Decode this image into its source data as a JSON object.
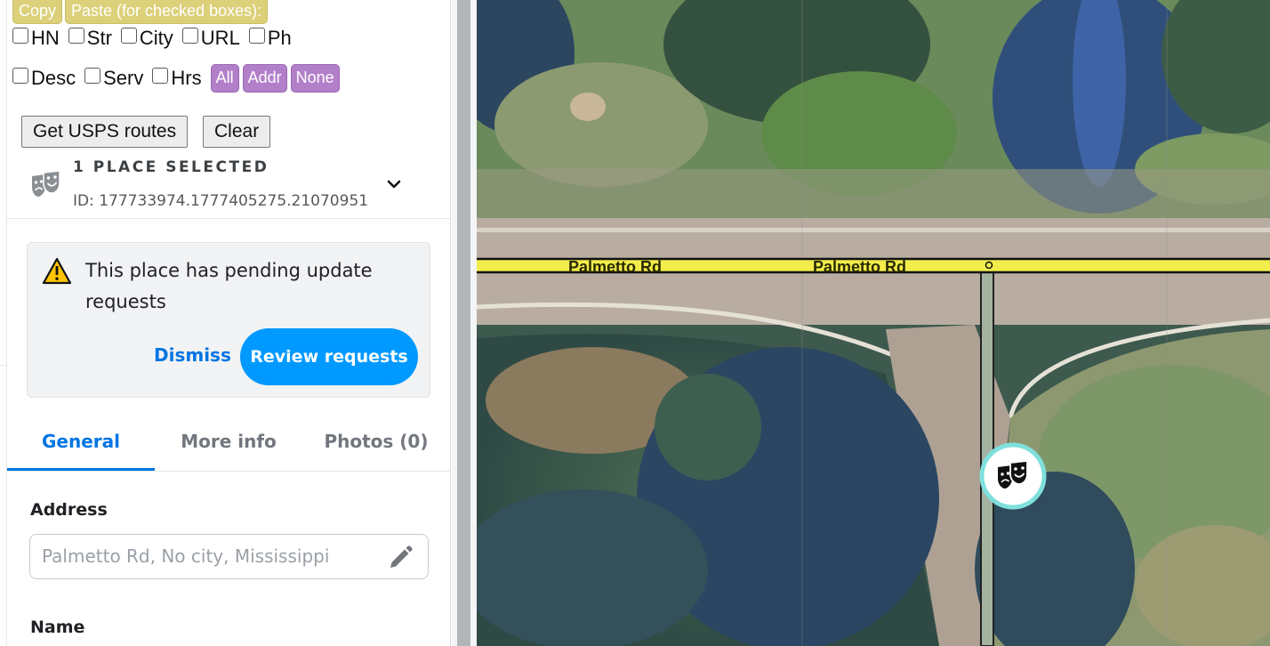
{
  "toolbar": {
    "copy_label": "Copy",
    "paste_label": "Paste (for checked boxes):"
  },
  "checkboxes_row1": [
    {
      "label": "HN",
      "checked": false
    },
    {
      "label": "Str",
      "checked": false
    },
    {
      "label": "City",
      "checked": false
    },
    {
      "label": "URL",
      "checked": false
    },
    {
      "label": "Ph",
      "checked": false
    }
  ],
  "checkboxes_row2": [
    {
      "label": "Desc",
      "checked": false
    },
    {
      "label": "Serv",
      "checked": false
    },
    {
      "label": "Hrs",
      "checked": false
    }
  ],
  "quick_buttons": {
    "all": "All",
    "addr": "Addr",
    "none": "None"
  },
  "usps": {
    "get_routes_label": "Get USPS routes",
    "clear_label": "Clear"
  },
  "selection": {
    "title": "1 PLACE SELECTED",
    "id_text": "ID: 177733974.1777405275.21070951",
    "icon": "theater-masks-icon"
  },
  "alert": {
    "message": "This place has pending update requests",
    "dismiss_label": "Dismiss",
    "review_label": "Review requests",
    "icon": "warning-triangle-icon"
  },
  "tabs": [
    {
      "label": "General",
      "active": true
    },
    {
      "label": "More info",
      "active": false
    },
    {
      "label": "Photos (0)",
      "active": false
    }
  ],
  "form": {
    "address_label": "Address",
    "address_value": "Palmetto Rd, No city, Mississippi",
    "name_label": "Name"
  },
  "map": {
    "road_name_left": "Palmetto Rd",
    "road_name_right": "Palmetto Rd",
    "marker_icon": "theater-masks-icon",
    "colors": {
      "road_fill": "#f2ed4a",
      "marker_ring": "#7fe0dc",
      "marker_fill": "#ffffff"
    }
  },
  "colors": {
    "accent": "#0075e3",
    "primary_button": "#0099ff",
    "script_button_yellow": "#dcd07a",
    "script_button_purple": "#b27fc9"
  }
}
